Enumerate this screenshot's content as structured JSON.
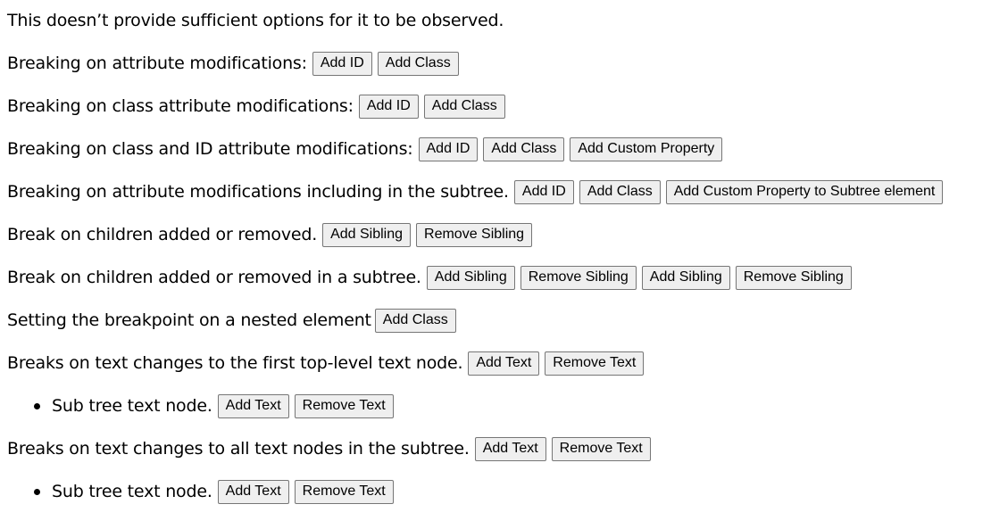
{
  "intro": "This doesn’t provide sufficient options for it to be observed.",
  "rows": [
    {
      "label": "Breaking on attribute modifications:",
      "buttons": [
        "Add ID",
        "Add Class"
      ]
    },
    {
      "label": "Breaking on class attribute modifications:",
      "buttons": [
        "Add ID",
        "Add Class"
      ]
    },
    {
      "label": "Breaking on class and ID attribute modifications:",
      "buttons": [
        "Add ID",
        "Add Class",
        "Add Custom Property"
      ]
    },
    {
      "label": "Breaking on attribute modifications including in the subtree.",
      "buttons": [
        "Add ID",
        "Add Class",
        "Add Custom Property to Subtree element"
      ]
    },
    {
      "label": "Break on children added or removed.",
      "buttons": [
        "Add Sibling",
        "Remove Sibling"
      ]
    },
    {
      "label": "Break on children added or removed in a subtree.",
      "buttons": [
        "Add Sibling",
        "Remove Sibling",
        "Add Sibling",
        "Remove Sibling"
      ]
    },
    {
      "label": "Setting the breakpoint on a nested element",
      "buttons": [
        "Add Class"
      ]
    },
    {
      "label": "Breaks on text changes to the first top-level text node.",
      "buttons": [
        "Add Text",
        "Remove Text"
      ]
    },
    {
      "label": "Sub tree text node.",
      "buttons": [
        "Add Text",
        "Remove Text"
      ],
      "bullet": true
    },
    {
      "label": "Breaks on text changes to all text nodes in the subtree.",
      "buttons": [
        "Add Text",
        "Remove Text"
      ]
    },
    {
      "label": "Sub tree text node.",
      "buttons": [
        "Add Text",
        "Remove Text"
      ],
      "bullet": true
    }
  ]
}
